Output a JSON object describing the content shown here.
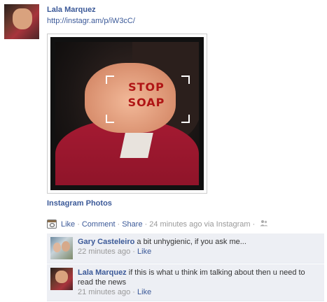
{
  "post": {
    "author": "Lala Marquez",
    "url": "http://instagr.am/p/iW3cC/",
    "photo_text": [
      "STOP",
      "SOAP"
    ],
    "app_link": "Instagram Photos"
  },
  "actions": {
    "like": "Like",
    "comment": "Comment",
    "share": "Share",
    "separator": "·",
    "timestamp": "24 minutes ago via Instagram"
  },
  "comments": [
    {
      "author": "Gary Casteleiro",
      "text": "a bit unhygienic, if you ask me...",
      "time": "22 minutes ago",
      "like": "Like"
    },
    {
      "author": "Lala Marquez",
      "text": "if this is what u think im talking about then u need to read the news",
      "time": "21 minutes ago",
      "like": "Like"
    }
  ]
}
